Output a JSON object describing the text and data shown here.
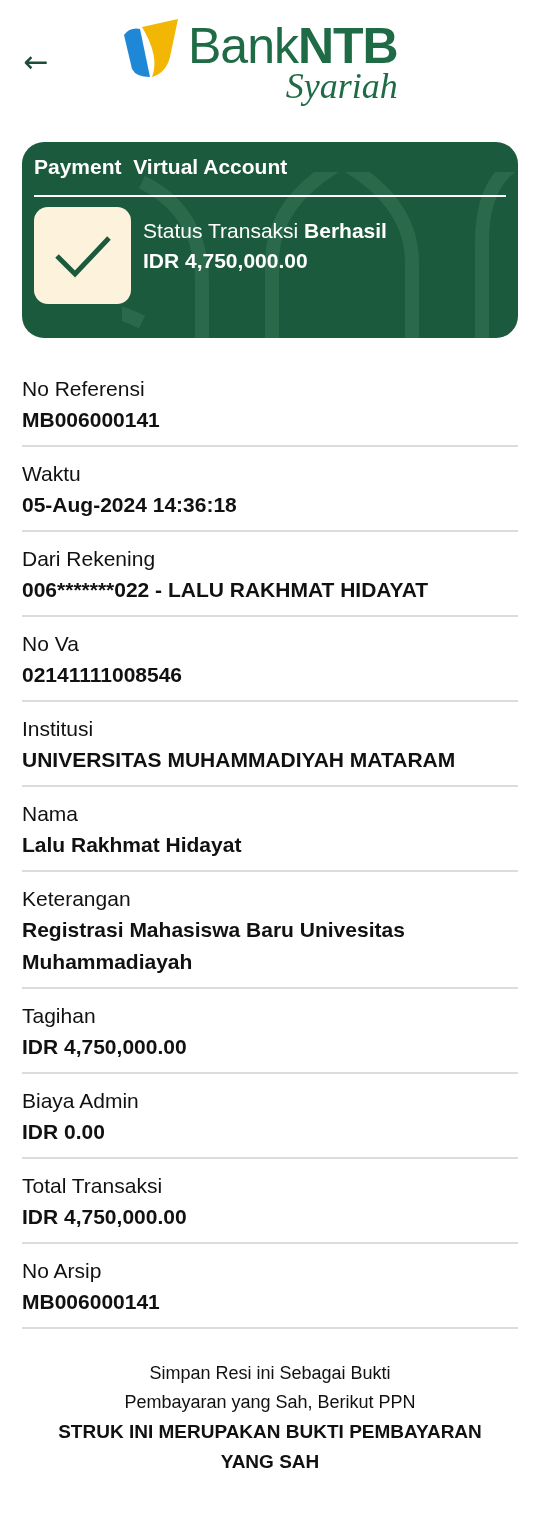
{
  "header": {
    "back": "←",
    "logo": {
      "word1": "Bank",
      "word2": "NTB",
      "tagline": "Syariah"
    }
  },
  "card": {
    "title": "Payment  Virtual Account",
    "status": "Status Transaksi **Berhasil**",
    "amount": "IDR 4,750,000.00",
    "success": true
  },
  "details": [
    {
      "label": "No Referensi",
      "value": "MB006000141"
    },
    {
      "label": "Waktu",
      "value": "05-Aug-2024 14:36:18"
    },
    {
      "label": "Dari Rekening",
      "value": "006*******022 - LALU RAKHMAT HIDAYAT"
    },
    {
      "label": "No Va",
      "value": "02141111008546"
    },
    {
      "label": "Institusi",
      "value": "UNIVERSITAS MUHAMMADIYAH MATARAM"
    },
    {
      "label": "Nama",
      "value": "Lalu Rakhmat Hidayat"
    },
    {
      "label": "Keterangan",
      "value": "Registrasi Mahasiswa Baru Univesitas Muhammadiayah"
    },
    {
      "label": "Tagihan",
      "value": "IDR 4,750,000.00"
    },
    {
      "label": "Biaya Admin",
      "value": "IDR 0.00"
    },
    {
      "label": "Total Transaksi",
      "value": "IDR 4,750,000.00"
    },
    {
      "label": "No Arsip",
      "value": "MB006000141"
    }
  ],
  "footer": {
    "note": "Simpan Resi ini Sebagai Bukti Pembayaran yang Sah, Berikut PPN",
    "statement": "STRUK INI MERUPAKAN BUKTI PEMBAYARAN YANG SAH"
  }
}
